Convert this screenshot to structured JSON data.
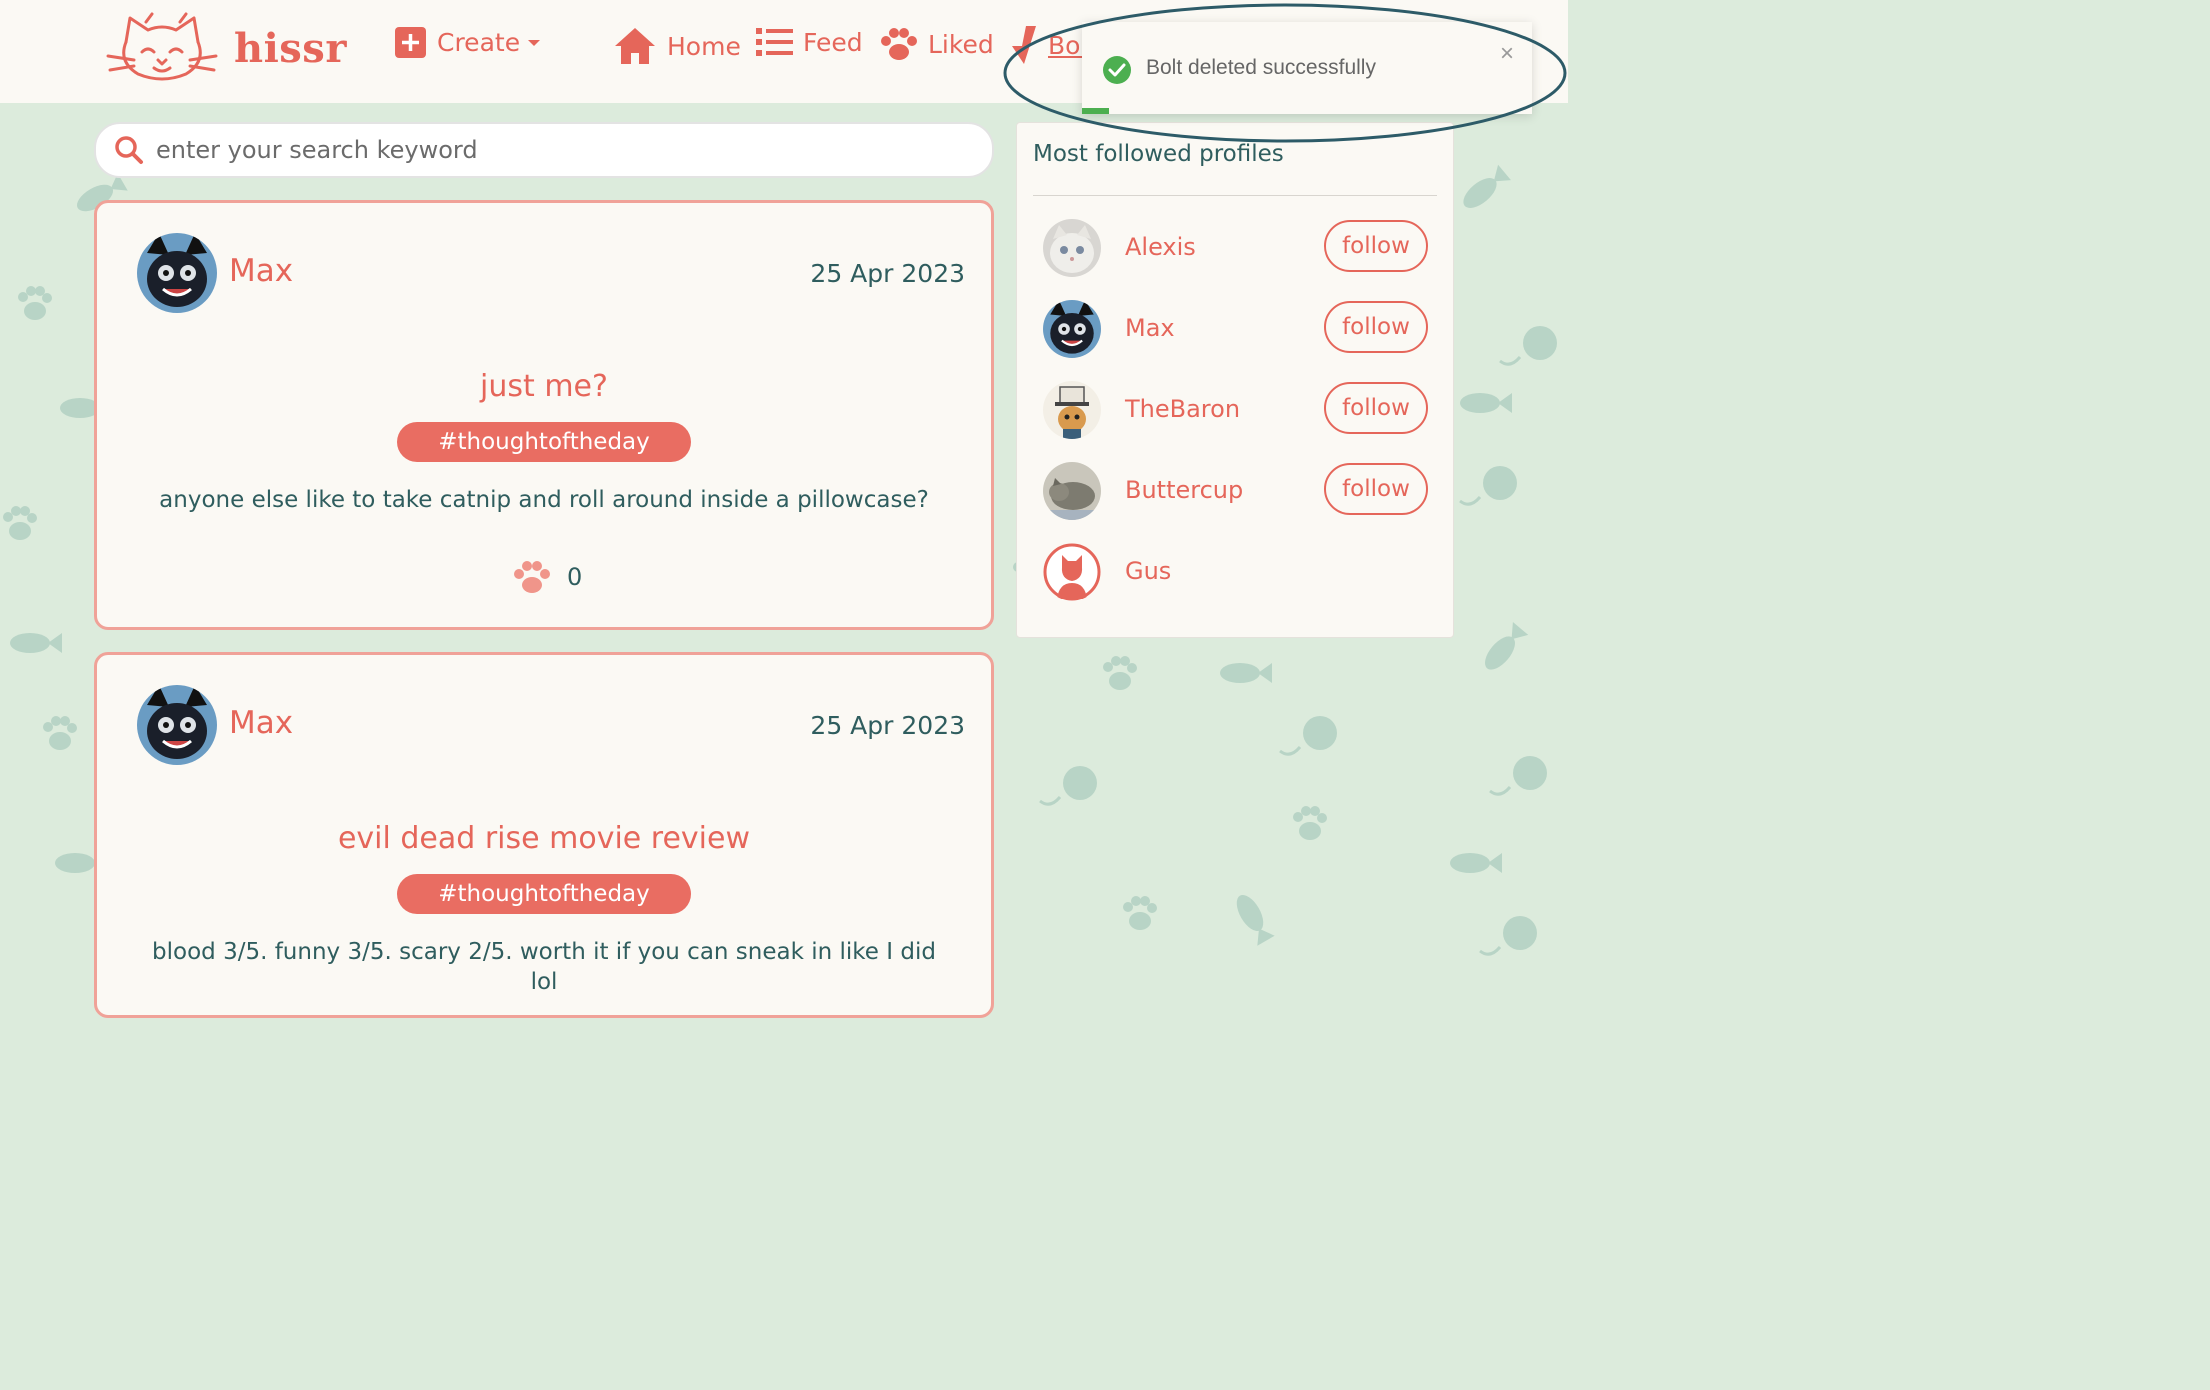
{
  "brand": {
    "name": "hissr",
    "logo_icon": "cat-face-logo-icon"
  },
  "colors": {
    "accent": "#e5665a",
    "text_dark": "#2f5d5e",
    "background": "#dcebdc",
    "card": "#fbf9f4",
    "success": "#4caf50"
  },
  "nav": {
    "create": "Create",
    "home": "Home",
    "feed": "Feed",
    "liked": "Liked",
    "bolt_partial": "Bol"
  },
  "toast": {
    "message": "Bolt deleted successfully",
    "close": "×"
  },
  "search": {
    "placeholder": "enter your search keyword"
  },
  "posts": [
    {
      "author": "Max",
      "date": "25 Apr 2023",
      "title": "just me?",
      "tag": "#thoughtoftheday",
      "body": "anyone else like to take catnip and roll around inside a pillowcase?",
      "likes": "0"
    },
    {
      "author": "Max",
      "date": "25 Apr 2023",
      "title": "evil dead rise movie review",
      "tag": "#thoughtoftheday",
      "body": "blood 3/5. funny 3/5. scary 2/5. worth it if you can sneak in like I did",
      "body_cont": "lol"
    }
  ],
  "sidebar": {
    "title": "Most followed profiles",
    "follow_label": "follow",
    "profiles": [
      {
        "name": "Alexis"
      },
      {
        "name": "Max"
      },
      {
        "name": "TheBaron"
      },
      {
        "name": "Buttercup"
      },
      {
        "name": "Gus"
      }
    ]
  }
}
